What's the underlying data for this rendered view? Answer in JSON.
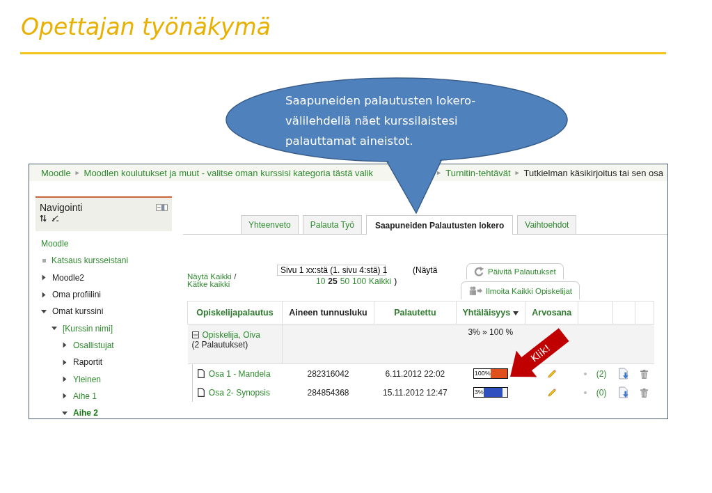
{
  "slide": {
    "title": "Opettajan työnäkymä"
  },
  "callout": {
    "lines": [
      "Saapuneiden palautusten lokero-",
      "välilehdellä näet kurssilaistesi",
      "palauttamat aineistot."
    ]
  },
  "annotation": {
    "text": "Klik!"
  },
  "breadcrumb": {
    "left": [
      {
        "label": "Moodle",
        "link": true
      },
      {
        "separator": "►",
        "label": "Moodlen koulutukset ja muut - valitse oman kurssisi kategoria tästä valik",
        "link": true
      }
    ],
    "right": [
      {
        "separator": "►",
        "label": "Turnitin-tehtävät",
        "link": true
      },
      {
        "separator": "►",
        "label": "Tutkielman käsikirjoitus tai sen osa",
        "link": false
      }
    ]
  },
  "navigation": {
    "title": "Navigointi",
    "items": [
      {
        "label": "Moodle",
        "kind": "plain",
        "link": true,
        "current": false
      },
      {
        "label": "Katsaus kursseistani",
        "kind": "leaf",
        "link": true,
        "current": false
      },
      {
        "label": "Moodle2",
        "kind": "branch",
        "expanded": false,
        "link": false,
        "current": false
      },
      {
        "label": "Oma profiilini",
        "kind": "branch",
        "expanded": false,
        "link": false,
        "current": false
      },
      {
        "label": "Omat kurssini",
        "kind": "branch",
        "expanded": true,
        "link": false,
        "current": false,
        "children": [
          {
            "label": "[Kurssin nimi]",
            "kind": "branch",
            "expanded": true,
            "link": true,
            "current": false,
            "children": [
              {
                "label": "Osallistujat",
                "kind": "branch",
                "expanded": false,
                "link": true,
                "current": false
              },
              {
                "label": "Raportit",
                "kind": "branch",
                "expanded": false,
                "link": false,
                "current": false
              },
              {
                "label": "Yleinen",
                "kind": "branch",
                "expanded": false,
                "link": true,
                "current": false
              },
              {
                "label": "Aihe 1",
                "kind": "branch",
                "expanded": false,
                "link": true,
                "current": false
              },
              {
                "label": "Aihe 2",
                "kind": "branch",
                "expanded": true,
                "link": true,
                "current": true
              }
            ]
          }
        ]
      }
    ]
  },
  "tabs": [
    {
      "label": "Yhteenveto",
      "selected": false
    },
    {
      "label": "Palauta Työ",
      "selected": false
    },
    {
      "label": "Saapuneiden Palautusten lokero",
      "selected": true
    },
    {
      "label": "Vaihtoehdot",
      "selected": false
    }
  ],
  "view_links": {
    "show": "Näytä Kaikki",
    "separator": "/",
    "hide": "Kätke kaikki"
  },
  "page_select": {
    "value": "Sivu 1 xx:stä (1. sivu 4:stä) 1"
  },
  "per_page": {
    "prefix": "(Näytä",
    "options": [
      {
        "label": "10",
        "selected": false
      },
      {
        "label": "25",
        "selected": true
      },
      {
        "label": "50",
        "selected": false
      },
      {
        "label": "100",
        "selected": false
      },
      {
        "label": "Kaikki",
        "selected": false
      }
    ],
    "suffix": ")"
  },
  "actions": [
    {
      "label": "Päivitä Palautukset",
      "kind": "refresh"
    },
    {
      "label": "Ilmoita Kaikki Opiskelijat",
      "kind": "notify"
    }
  ],
  "table": {
    "columns": [
      {
        "label": "Opiskelijapalautus",
        "link": true,
        "sorted": false
      },
      {
        "label": "Aineen tunnusluku",
        "link": false,
        "sorted": false
      },
      {
        "label": "Palautettu",
        "link": true,
        "sorted": false
      },
      {
        "label": "Yhtäläisyys",
        "link": true,
        "sorted": true
      },
      {
        "label": "Arvosana",
        "link": true,
        "sorted": false
      }
    ],
    "group": {
      "student": "Opiskelija, Oiva",
      "count": "(2 Palautukset)",
      "similarity": "3% » 100 %",
      "expanded": true
    },
    "rows": [
      {
        "title": "Osa 1  -  Mandela",
        "paper_id": "282316042",
        "submitted": "6.11.2012 22:02",
        "similarity": "100%",
        "level": 1,
        "color": "#e0501c",
        "comments": "(2)"
      },
      {
        "title": "Osa  2- Synopsis",
        "paper_id": "284854368",
        "submitted": "15.11.2012 12:47",
        "similarity": "3%",
        "level": 0.8,
        "color": "#3050c0",
        "comments": "(0)"
      }
    ]
  }
}
